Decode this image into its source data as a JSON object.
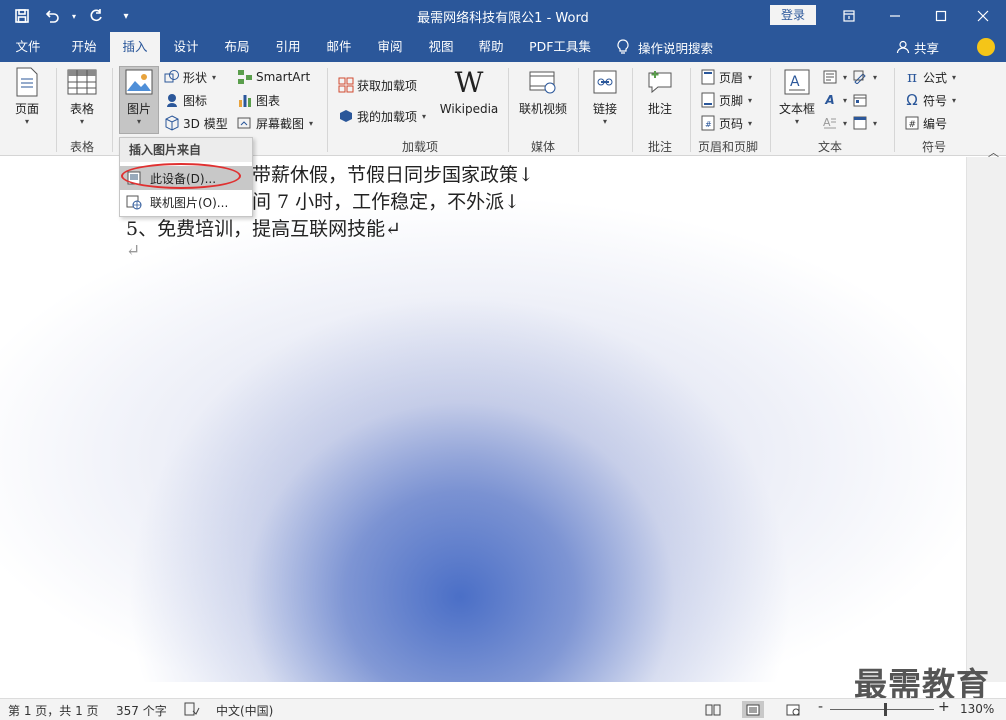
{
  "title": {
    "doc_name": "最需网络科技有限公1  -  Word",
    "login": "登录"
  },
  "tabs": [
    "文件",
    "开始",
    "插入",
    "设计",
    "布局",
    "引用",
    "邮件",
    "审阅",
    "视图",
    "帮助",
    "PDF工具集"
  ],
  "active_tab": "插入",
  "tell_me": "操作说明搜索",
  "share": "共享",
  "ribbon": {
    "page": {
      "label": "页面"
    },
    "table": {
      "label": "表格",
      "group": "表格"
    },
    "images": {
      "picture": "图片",
      "shapes": "形状",
      "icons": "图标",
      "model3d": "3D 模型"
    },
    "illustrations": {
      "smartart": "SmartArt",
      "chart": "图表",
      "screenshot": "屏幕截图"
    },
    "addins": {
      "get": "获取加载项",
      "my": "我的加载项",
      "wikipedia": "Wikipedia",
      "group": "加载项"
    },
    "media": {
      "online_video": "联机视频",
      "group": "媒体"
    },
    "links": {
      "link": "链接"
    },
    "comments": {
      "comment": "批注",
      "group": "批注"
    },
    "header_footer": {
      "header": "页眉",
      "footer": "页脚",
      "page_number": "页码",
      "group": "页眉和页脚"
    },
    "text": {
      "textbox": "文本框",
      "group": "文本"
    },
    "symbols": {
      "equation": "公式",
      "symbol": "符号",
      "number": "编号",
      "group": "符号"
    }
  },
  "dropdown": {
    "header": "插入图片来自",
    "items": [
      "此设备(D)...",
      "联机图片(O)..."
    ]
  },
  "document": {
    "lines": [
      "带薪休假，节假日同步国家政策↓",
      "间 7 小时，工作稳定，不外派↓",
      "5、免费培训，提高互联网技能↵",
      "↵"
    ]
  },
  "watermark": "最需教育",
  "status": {
    "page": "第 1 页，共 1 页",
    "words": "357 个字",
    "language": "中文(中国)",
    "zoom_percent": "130%",
    "zoom_minus": "-",
    "zoom_plus": "+"
  },
  "colors": {
    "accent": "#2b579a",
    "ribbon_bg": "#f3f3f3",
    "highlight_ellipse": "#e03030"
  }
}
